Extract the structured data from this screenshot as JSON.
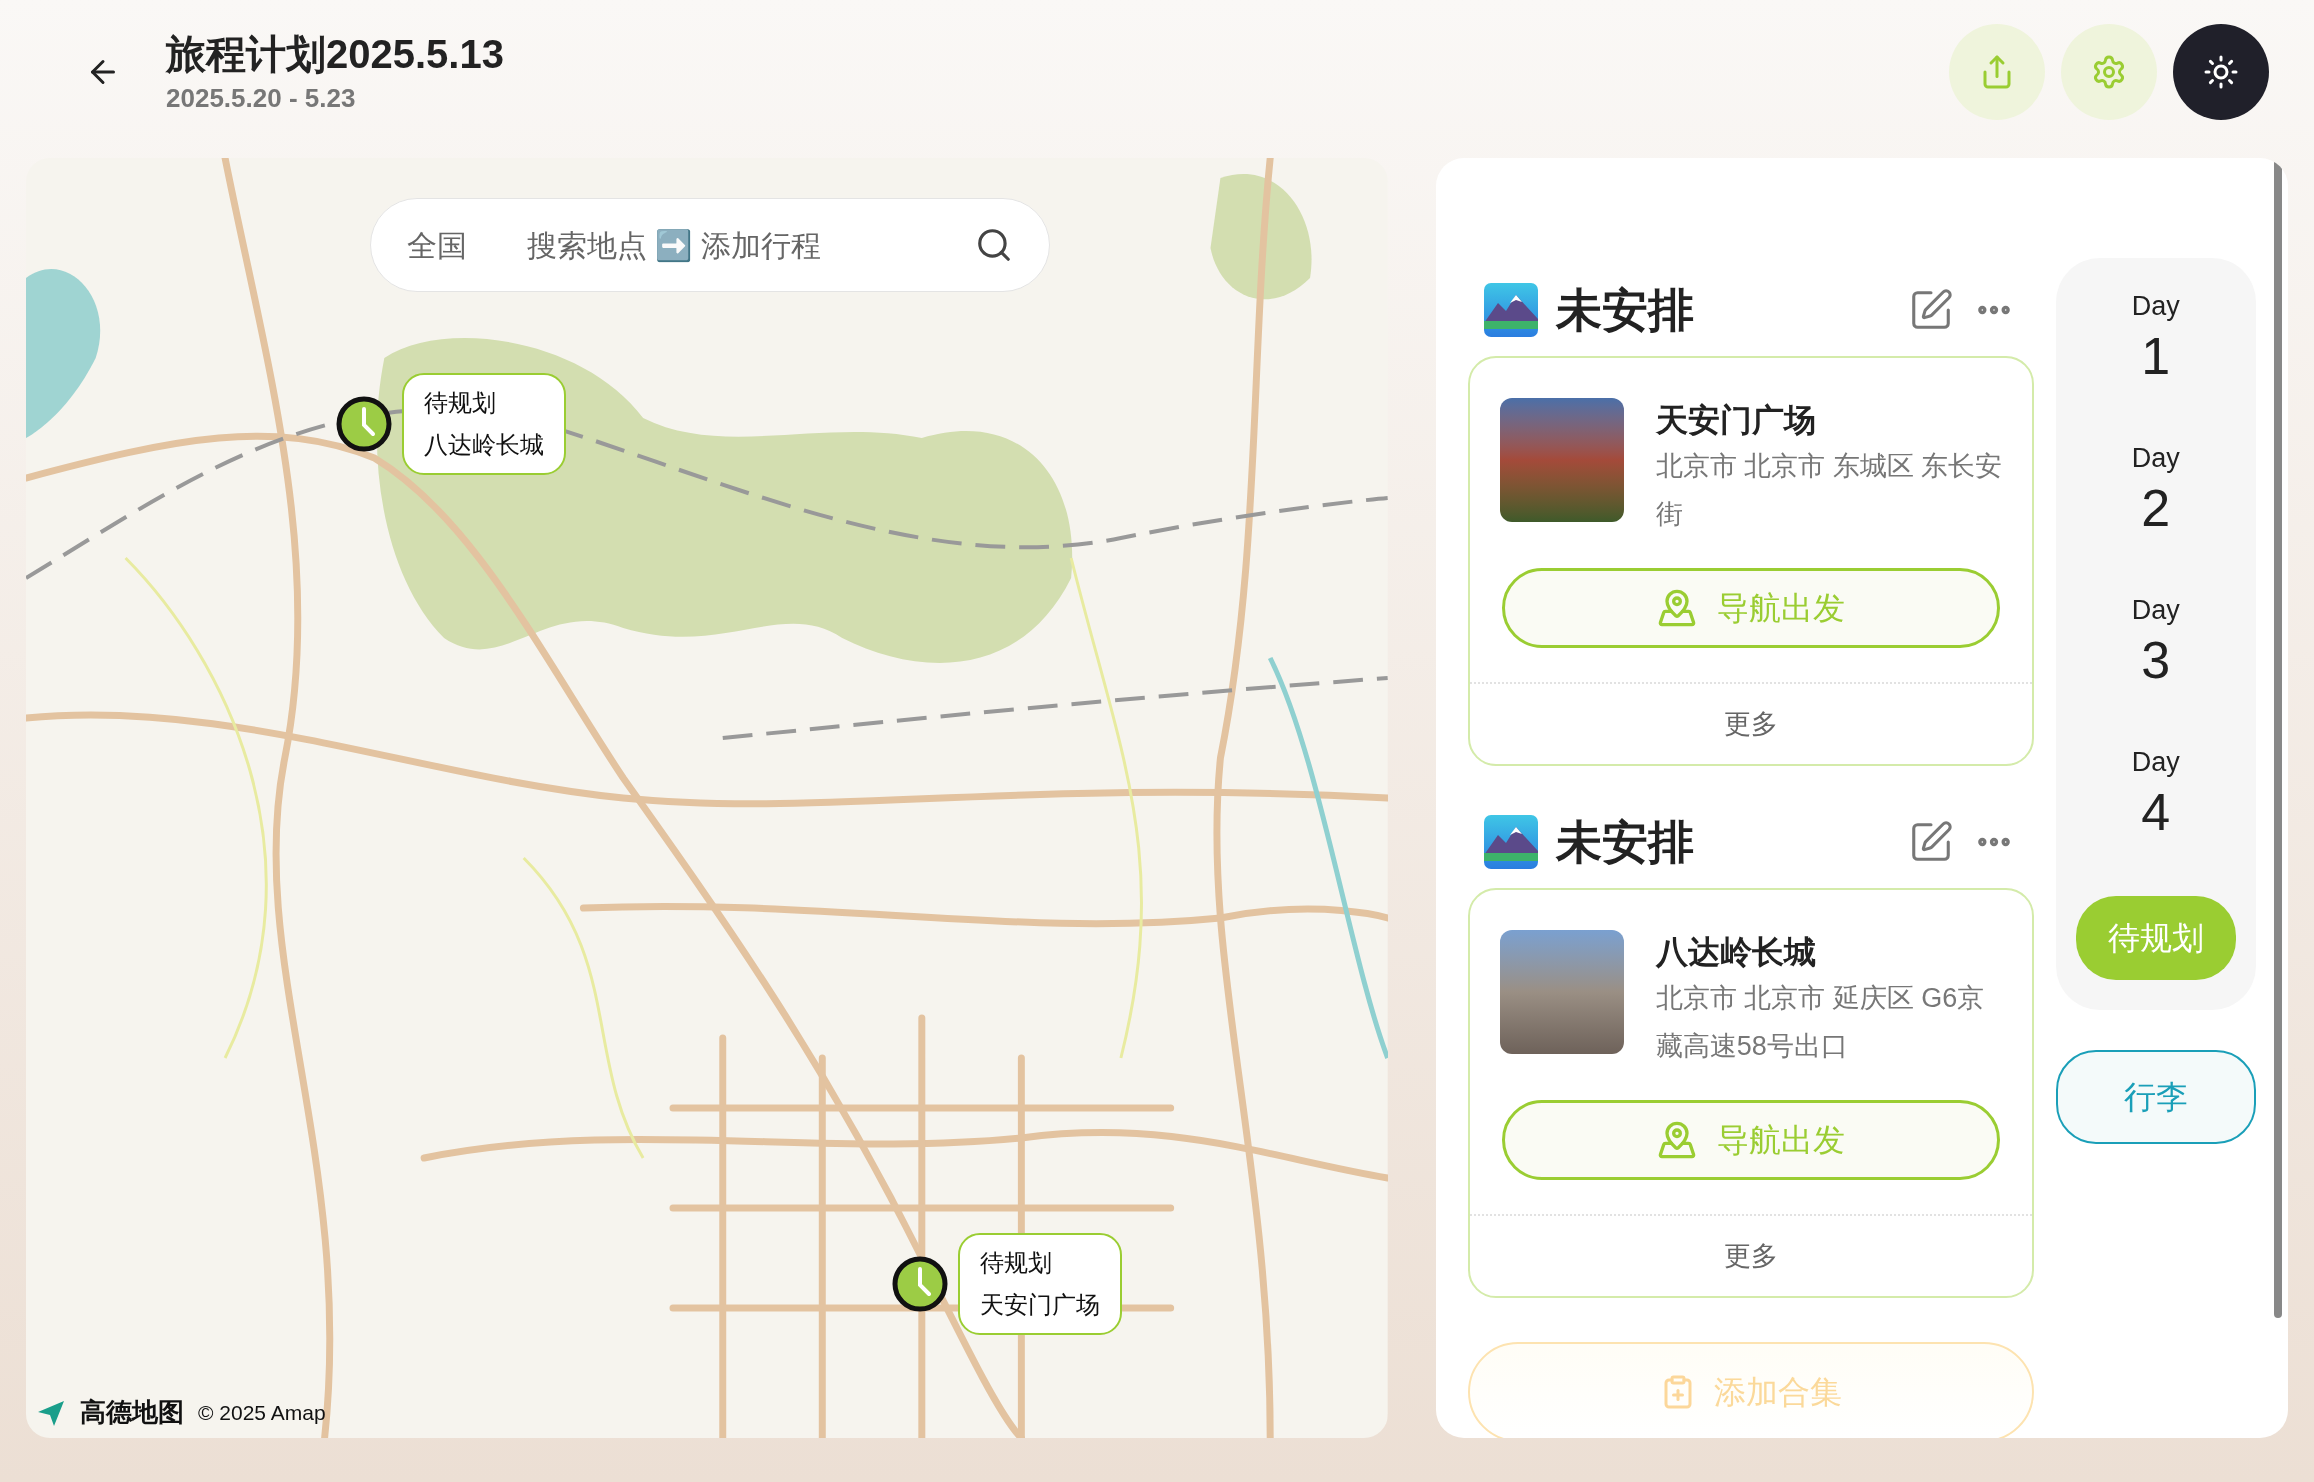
{
  "header": {
    "title": "旅程计划2025.5.13",
    "dates": "2025.5.20 - 5.23"
  },
  "search": {
    "scope": "全国",
    "placeholder": "搜索地点 ➡️ 添加行程"
  },
  "markers": [
    {
      "status": "待规划",
      "name": "八达岭长城"
    },
    {
      "status": "待规划",
      "name": "天安门广场"
    }
  ],
  "attribution": {
    "logo": "高德地图",
    "copyright": "© 2025 Amap"
  },
  "groups": [
    {
      "title": "未安排",
      "place": {
        "name": "天安门广场",
        "address": "北京市 北京市 东城区 东长安街"
      },
      "nav_label": "导航出发",
      "more_label": "更多"
    },
    {
      "title": "未安排",
      "place": {
        "name": "八达岭长城",
        "address": "北京市 北京市 延庆区 G6京藏高速58号出口"
      },
      "nav_label": "导航出发",
      "more_label": "更多"
    }
  ],
  "add_collection": "添加合集",
  "day_tabs": [
    {
      "kind": "day",
      "label": "Day",
      "number": "1",
      "selected": false
    },
    {
      "kind": "day",
      "label": "Day",
      "number": "2",
      "selected": false
    },
    {
      "kind": "day",
      "label": "Day",
      "number": "3",
      "selected": false
    },
    {
      "kind": "day",
      "label": "Day",
      "number": "4",
      "selected": false
    },
    {
      "kind": "pending",
      "label": "待规划",
      "selected": true
    }
  ],
  "luggage_button": "行李"
}
